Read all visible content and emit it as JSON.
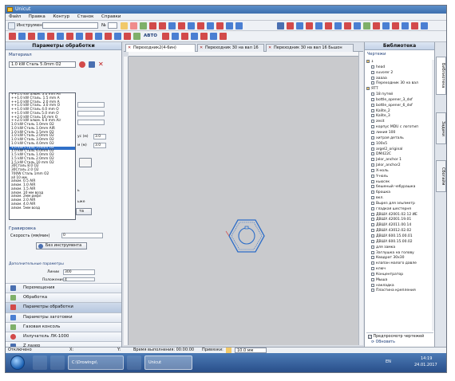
{
  "title": "Unicut",
  "menu": [
    "Файл",
    "Правка",
    "Контур",
    "Станок",
    "Справки"
  ],
  "toolbar": {
    "tool_label": "Инструмент",
    "num_label": "№",
    "auto_label": "АВТО"
  },
  "left_panel": {
    "title": "Параметры обработки",
    "material_label": "Материал",
    "material_selected": "1.0 kW Сталь 5.0mm O2",
    "material_options": [
      "++1.0 kW алюм. 3.0 mm Air",
      "++1.0 kW Сталь. 1.5 mm A",
      "++1.0 kW Сталь. 2.0 mm A",
      "++1.0 kW Сталь. 3.0 mm O",
      "++1.0 kW Сталь 4.0 mm O",
      "++1.0 kW Сталь 5.0 mm O",
      "++2.0 kW Сталь 16 mm O",
      "++2.0 kW алюм. 6.0 mm Air",
      "1.0 kW Сталь 1.0mm O2",
      "1.0 kW Сталь 1.0mm AIR",
      "1.0 kW Сталь 1.5mm O2",
      "1.0 kW Сталь 2.0mm O2",
      "1.0 kW Сталь 3.0mm O2",
      "1.0 kW Сталь 4.0mm O2",
      "1.0 kW Сталь 5.0mm O2",
      "1.0 kW Сталь 6.0mm O2",
      "1.5 kW Сталь 1.0mm O2",
      "1.5 kW Сталь 2.0mm O2",
      "1.5 kW Сталь 10 mm O2",
      "30Сталь 8.0 O2",
      "30Сталь 2.0 O2",
      "700W Сталь 1mm O2",
      "all 10 мм",
      "алюм. 0.5 AIR",
      "алюм. 1.0 AIR",
      "алюм. 1.5 AIR",
      "алюм. 10 мм возд",
      "алюм. 2мм рифл",
      "алюм. 2.0 AIR",
      "алюм. 4.0 AIR",
      "алюм. 5мм возд"
    ],
    "selected_index": 14,
    "field_label_1": "ус (м)",
    "field_value_1": "3.0",
    "field_label_2": "м (м)",
    "field_value_2": "3.0",
    "partial_label_1": "ь",
    "partial_label_2": "ьже",
    "partial_button": "та",
    "engraving_label": "Гравировка",
    "speed_label": "Скорость (мм/мин)",
    "speed_value": "0",
    "no_tool_button": "Без инструмента",
    "extra_params_label": "Дополнительные параметры",
    "lines_label": "Линии",
    "lines_value": "300",
    "position_label": "Положение",
    "position_value": "4",
    "nav_items": [
      "Перемещения",
      "Обработка",
      "Параметры обработки",
      "Параметры заготовки",
      "Газовая консоль",
      "Излучатель ЛК-1000",
      "Z лазер"
    ]
  },
  "tabs": [
    "Переходник2(4-6ин)",
    "Переходник 30 на вал 16",
    "Переходник 30 на вал 16 Бьшон"
  ],
  "library": {
    "title": "Библиотека",
    "section_label": "Чертежи",
    "items": [
      "1",
      "head",
      "suvorer 2",
      "ааааа",
      "Переходник 30 на вал",
      "ЯТТ",
      "18 путей",
      "bottle_opener_3_dxf",
      "bottle_opener_6_dxf",
      "Kalite_2",
      "Kalite_3",
      "zesit",
      "корпус MDU с логотип",
      "линия 100",
      "хитрая деталь",
      "100x5",
      "argel2_original",
      "DM422C",
      "Jalor_anchor 1",
      "Jalor_anchor2",
      "X-ноль",
      "Y-ноль",
      "кьюсек",
      "бешеный чебурашка",
      "брошка",
      "вкл.",
      "Вырез для эльпметр",
      "гладкая шестерня",
      "ДВШУ.42001.02.12 ИЕ",
      "ДВШУ.42001.19.01",
      "ДВШУ.42011.00.14",
      "ДВШУ.43012.02.02",
      "ДВШУ.600.15.00.01",
      "ДВШУ.600.15.00.02",
      "для замка",
      "Заглушка на голову",
      "Квадрат 30x30",
      "клапан малого давле",
      "ключ",
      "Концентратор",
      "Мыша",
      "накладка",
      "Пластина крепления"
    ],
    "preview_label": "Предпросмотр чертежей",
    "refresh_label": "Обновить"
  },
  "side_tabs": [
    "Библиотека",
    "Задачи",
    "Сбогайм"
  ],
  "status": {
    "state": "Отключено",
    "x_label": "X:",
    "y_label": "Y:",
    "time_label": "Время выполнения: 00:00:00",
    "snap_label": "Привязки:",
    "snap_value": "10.0 мм"
  },
  "taskbar": {
    "explorer_label": "C:\\Drowings\\",
    "app_label": "Unicut",
    "lang": "EN",
    "time": "14:19",
    "date": "24.01.2017"
  }
}
